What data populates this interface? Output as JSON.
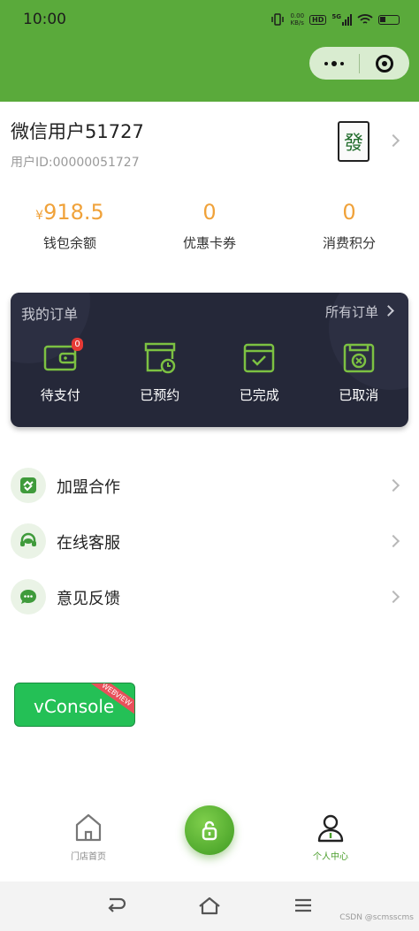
{
  "status_bar": {
    "time": "10:00",
    "speed_value": "0.00",
    "speed_unit": "KB/s",
    "hd_badge": "HD",
    "network": "5G"
  },
  "user": {
    "name": "微信用户51727",
    "id_label": "用户ID:00000051727",
    "avatar_char": "發"
  },
  "stats": [
    {
      "currency": "¥",
      "value": "918.5",
      "label": "钱包余额"
    },
    {
      "value": "0",
      "label": "优惠卡券"
    },
    {
      "value": "0",
      "label": "消费积分"
    }
  ],
  "orders": {
    "title": "我的订单",
    "all_label": "所有订单",
    "items": [
      {
        "label": "待支付",
        "badge": "0",
        "icon": "wallet-icon"
      },
      {
        "label": "已预约",
        "icon": "calendar-clock-icon"
      },
      {
        "label": "已完成",
        "icon": "check-box-icon"
      },
      {
        "label": "已取消",
        "icon": "cancel-box-icon"
      }
    ]
  },
  "menu": [
    {
      "label": "加盟合作",
      "icon": "handshake-icon"
    },
    {
      "label": "在线客服",
      "icon": "headset-icon"
    },
    {
      "label": "意见反馈",
      "icon": "chat-bubble-icon"
    }
  ],
  "vconsole": {
    "label": "vConsole",
    "ribbon": "WEBVIEW"
  },
  "tabbar": {
    "home_label": "门店首页",
    "profile_label": "个人中心",
    "active_color": "#4a9e2b"
  },
  "watermark": "CSDN @scmsscms",
  "colors": {
    "brand": "#5aaa3b",
    "accent": "#f0a23a",
    "card_bg": "#252839"
  }
}
